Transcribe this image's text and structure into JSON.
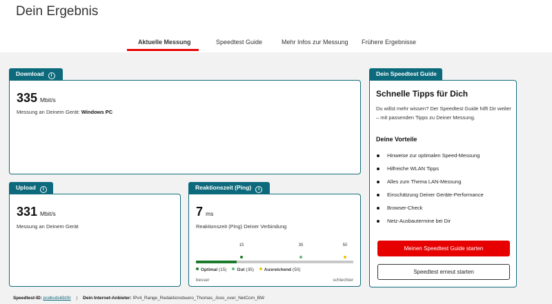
{
  "page": {
    "title": "Dein Ergebnis"
  },
  "tabs": [
    {
      "label": "Aktuelle Messung",
      "active": true
    },
    {
      "label": "Speedtest Guide",
      "active": false
    },
    {
      "label": "Mehr Infos zur Messung",
      "active": false
    },
    {
      "label": "Frühere Ergebnisse",
      "active": false
    }
  ],
  "download": {
    "label": "Download",
    "value": "335",
    "unit": "Mbit/s",
    "desc_prefix": "Messung an Deinem Gerät:",
    "device": "Windows PC"
  },
  "upload": {
    "label": "Upload",
    "value": "331",
    "unit": "Mbit/s",
    "desc": "Messung an Deinem Gerät"
  },
  "ping": {
    "label": "Reaktionszeit (Ping)",
    "value": "7",
    "unit": "ms",
    "desc": "Reaktionszeit (Ping) Deiner Verbindung",
    "ticks": [
      "15",
      "35",
      "50"
    ],
    "legend": [
      {
        "name": "Optimal",
        "range": "(15)",
        "color": "#1a7a2c"
      },
      {
        "name": "Gut",
        "range": "(35)",
        "color": "#5fb87a"
      },
      {
        "name": "Ausreichend",
        "range": "(50)",
        "color": "#f2c200"
      }
    ],
    "better": "besser",
    "worse": "schlechter",
    "fill_fraction": 0.26
  },
  "guide": {
    "tab_label": "Dein Speedtest Guide",
    "title": "Schnelle Tipps für Dich",
    "intro": "Du willst mehr wissen? Der Speedtest Guide hilft Dir weiter – mit passenden Tipps zu Deiner Messung.",
    "advantages_title": "Deine Vorteile",
    "advantages": [
      "Hinweise zur optimalen Speed-Messung",
      "Hilfreiche WLAN Tipps",
      "Alles zum Thema LAN-Messung",
      "Einschätzung Deiner Geräte-Performance",
      "Browser-Check",
      "Netz-Ausbautermine bei Dir"
    ],
    "start_button": "Meinen Speedtest Guide starten",
    "restart_button": "Speedtest erneut starten"
  },
  "footer": {
    "id_label": "Speedtest-ID:",
    "id_value": "pcdkvds69z9r",
    "provider_label": "Dein Internet-Anbieter:",
    "provider_value": "IPv4_Range_Redaktionsbuero_Thomas_Joos_over_NetCom_BW"
  },
  "colors": {
    "accent": "#e60000",
    "card_border": "#0d6a7c"
  }
}
